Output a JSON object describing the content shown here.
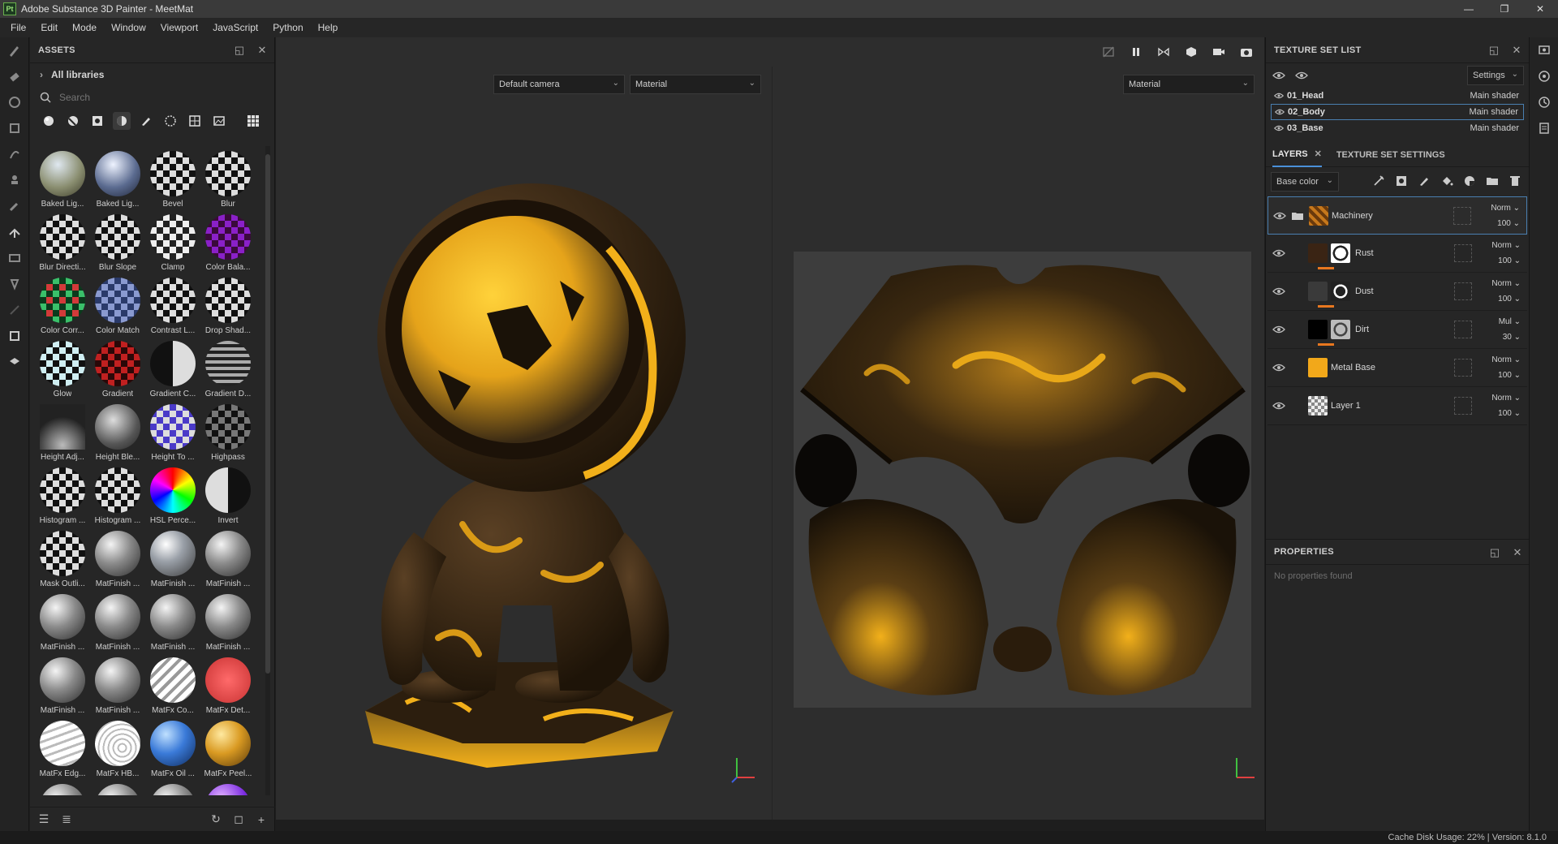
{
  "window": {
    "title": "Adobe Substance 3D Painter - MeetMat",
    "logo": "Pt",
    "controls": [
      "—",
      "❐",
      "✕"
    ]
  },
  "menu": [
    "File",
    "Edit",
    "Mode",
    "Window",
    "Viewport",
    "JavaScript",
    "Python",
    "Help"
  ],
  "left_toolbar": {
    "icons": [
      "paint-brush-icon",
      "eraser-icon",
      "projection-icon",
      "geometry-mask-icon",
      "smudge-icon",
      "clone-stamp-icon",
      "color-picker-icon",
      "bake-icon",
      "material-icon",
      "anchor-icon",
      "measure-icon",
      "export-icon",
      "gallery-icon"
    ]
  },
  "assets": {
    "title": "ASSETS",
    "library": "All libraries",
    "search_placeholder": "Search",
    "items": [
      {
        "name": "Baked Lig...",
        "kind": "env"
      },
      {
        "name": "Baked Lig...",
        "kind": "env2"
      },
      {
        "name": "Bevel",
        "kind": "checker"
      },
      {
        "name": "Blur",
        "kind": "checker"
      },
      {
        "name": "Blur Directi...",
        "kind": "checker"
      },
      {
        "name": "Blur Slope",
        "kind": "checker"
      },
      {
        "name": "Clamp",
        "kind": "checkerlight"
      },
      {
        "name": "Color Bala...",
        "kind": "purple"
      },
      {
        "name": "Color Corr...",
        "kind": "green"
      },
      {
        "name": "Color Match",
        "kind": "blue"
      },
      {
        "name": "Contrast L...",
        "kind": "checker"
      },
      {
        "name": "Drop Shad...",
        "kind": "checker"
      },
      {
        "name": "Glow",
        "kind": "teal"
      },
      {
        "name": "Gradient",
        "kind": "red"
      },
      {
        "name": "Gradient C...",
        "kind": "halfdark"
      },
      {
        "name": "Gradient D...",
        "kind": "lines"
      },
      {
        "name": "Height Adj...",
        "kind": "height"
      },
      {
        "name": "Height Ble...",
        "kind": "metalrough"
      },
      {
        "name": "Height To ...",
        "kind": "bluepurple"
      },
      {
        "name": "Highpass",
        "kind": "checkerdark"
      },
      {
        "name": "Histogram ...",
        "kind": "checker"
      },
      {
        "name": "Histogram ...",
        "kind": "checker"
      },
      {
        "name": "HSL Perce...",
        "kind": "rainbow"
      },
      {
        "name": "Invert",
        "kind": "invert"
      },
      {
        "name": "Mask Outli...",
        "kind": "checker"
      },
      {
        "name": "MatFinish ...",
        "kind": "metal"
      },
      {
        "name": "MatFinish ...",
        "kind": "metal2"
      },
      {
        "name": "MatFinish ...",
        "kind": "metal"
      },
      {
        "name": "MatFinish ...",
        "kind": "metal"
      },
      {
        "name": "MatFinish ...",
        "kind": "metal"
      },
      {
        "name": "MatFinish ...",
        "kind": "metal"
      },
      {
        "name": "MatFinish ...",
        "kind": "metal"
      },
      {
        "name": "MatFinish ...",
        "kind": "metal"
      },
      {
        "name": "MatFinish ...",
        "kind": "metal"
      },
      {
        "name": "MatFx Co...",
        "kind": "stripes"
      },
      {
        "name": "MatFx Det...",
        "kind": "redcross"
      },
      {
        "name": "MatFx Edg...",
        "kind": "whitestripes"
      },
      {
        "name": "MatFx HB...",
        "kind": "whiterings"
      },
      {
        "name": "MatFx Oil ...",
        "kind": "blueoil"
      },
      {
        "name": "MatFx Peel...",
        "kind": "gold"
      },
      {
        "name": "",
        "kind": "metal"
      },
      {
        "name": "",
        "kind": "metal"
      },
      {
        "name": "",
        "kind": "metal"
      },
      {
        "name": "",
        "kind": "violet"
      }
    ]
  },
  "viewport": {
    "camera": "Default camera",
    "mode_3d": "Material",
    "mode_2d": "Material",
    "toolbar_icons": [
      "hide-ui-icon",
      "pause-icon",
      "symmetry-icon",
      "display-mode-icon",
      "camera-icon",
      "screenshot-icon"
    ]
  },
  "texture_set_list": {
    "title": "TEXTURE SET LIST",
    "settings": "Settings",
    "sets": [
      {
        "name": "01_Head",
        "shader": "Main shader",
        "selected": false
      },
      {
        "name": "02_Body",
        "shader": "Main shader",
        "selected": true
      },
      {
        "name": "03_Base",
        "shader": "Main shader",
        "selected": false
      }
    ]
  },
  "layers": {
    "tab_layers": "LAYERS",
    "tab_settings": "TEXTURE SET SETTINGS",
    "channel": "Base color",
    "items": [
      {
        "name": "Machinery",
        "blend": "Norm",
        "opacity": "100",
        "type": "folder",
        "selected": true
      },
      {
        "name": "Rust",
        "blend": "Norm",
        "opacity": "100",
        "type": "fill",
        "selected": false
      },
      {
        "name": "Dust",
        "blend": "Norm",
        "opacity": "100",
        "type": "fill",
        "selected": false
      },
      {
        "name": "Dirt",
        "blend": "Mul",
        "opacity": "30",
        "type": "fill",
        "selected": false
      },
      {
        "name": "Metal Base",
        "blend": "Norm",
        "opacity": "100",
        "type": "fill",
        "selected": false
      },
      {
        "name": "Layer 1",
        "blend": "Norm",
        "opacity": "100",
        "type": "paint",
        "selected": false
      }
    ]
  },
  "properties": {
    "title": "PROPERTIES",
    "empty": "No properties found"
  },
  "status": {
    "text": "Cache Disk Usage:   22% | Version: 8.1.0"
  },
  "colors": {
    "accent": "#4a90d9",
    "orange": "#e8771f",
    "yellow": "#f2b01a"
  }
}
